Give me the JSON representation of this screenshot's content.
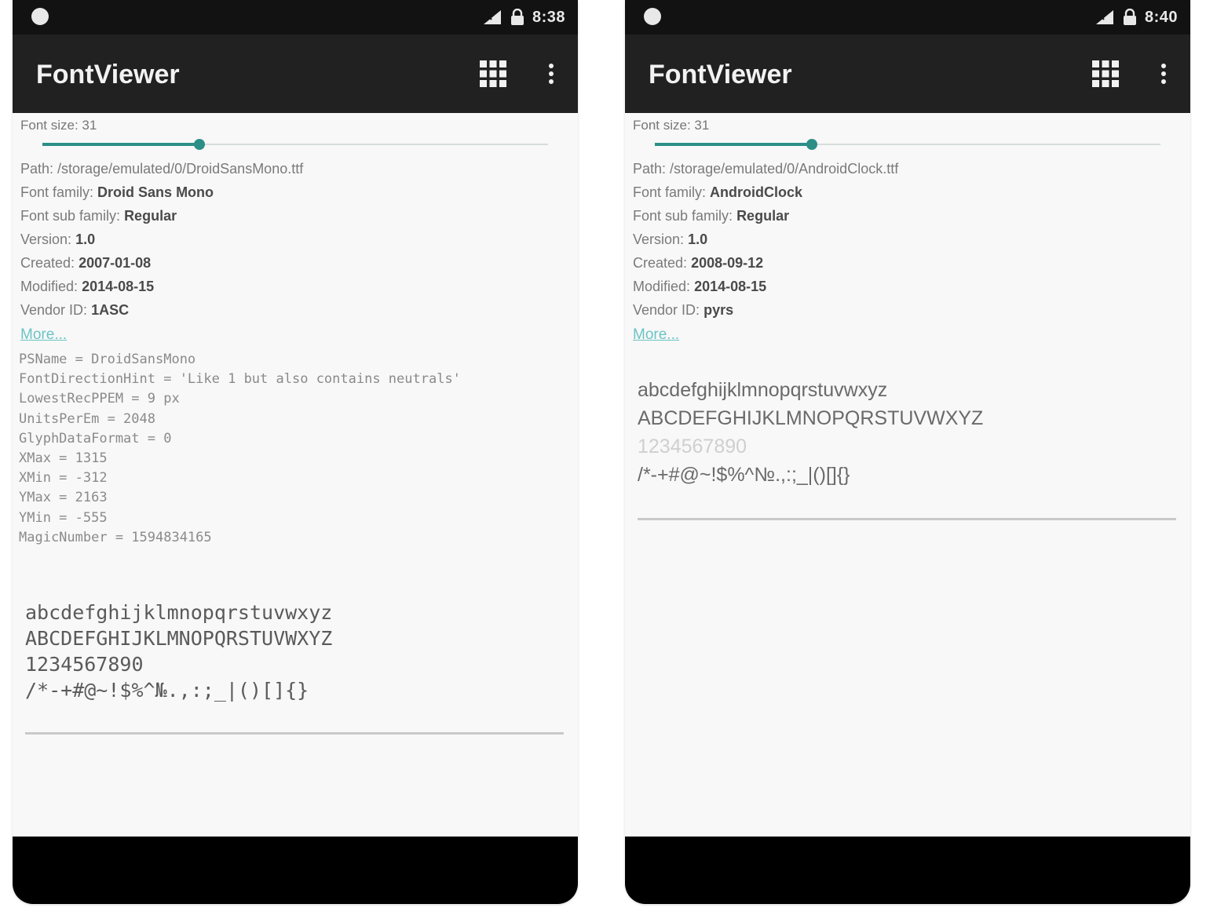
{
  "screens": [
    {
      "status": {
        "time": "8:38"
      },
      "app_bar": {
        "title": "FontViewer",
        "grid_icon": "grid-view-icon",
        "more_icon": "more-vert-icon"
      },
      "font_size": {
        "label": "Font size: 31",
        "slider_fraction": 0.31
      },
      "info": {
        "path_label": "Path:",
        "path_value": "/storage/emulated/0/DroidSansMono.ttf",
        "family_label": "Font family:",
        "family_value": "Droid Sans Mono",
        "subfamily_label": "Font sub family:",
        "subfamily_value": "Regular",
        "version_label": "Version:",
        "version_value": "1.0",
        "created_label": "Created:",
        "created_value": "2007-01-08",
        "modified_label": "Modified:",
        "modified_value": "2014-08-15",
        "vendor_label": "Vendor ID:",
        "vendor_value": "1ASC"
      },
      "more_link": "More...",
      "details": [
        "PSName = DroidSansMono",
        "FontDirectionHint = 'Like 1 but also contains neutrals'",
        "LowestRecPPEM = 9 px",
        "UnitsPerEm = 2048",
        "GlyphDataFormat = 0",
        "XMax = 1315",
        "XMin = -312",
        "YMax = 2163",
        "YMin = -555",
        "MagicNumber = 1594834165"
      ],
      "sample": {
        "lowercase": "abcdefghijklmnopqrstuvwxyz",
        "uppercase": "ABCDEFGHIJKLMNOPQRSTUVWXYZ",
        "digits": "1234567890",
        "symbols": "/*-+#@~!$%^№.,:;_|()[]{}"
      }
    },
    {
      "status": {
        "time": "8:40"
      },
      "app_bar": {
        "title": "FontViewer",
        "grid_icon": "grid-view-icon",
        "more_icon": "more-vert-icon"
      },
      "font_size": {
        "label": "Font size: 31",
        "slider_fraction": 0.31
      },
      "info": {
        "path_label": "Path:",
        "path_value": "/storage/emulated/0/AndroidClock.ttf",
        "family_label": "Font family:",
        "family_value": "AndroidClock",
        "subfamily_label": "Font sub family:",
        "subfamily_value": "Regular",
        "version_label": "Version:",
        "version_value": "1.0",
        "created_label": "Created:",
        "created_value": "2008-09-12",
        "modified_label": "Modified:",
        "modified_value": "2014-08-15",
        "vendor_label": "Vendor ID:",
        "vendor_value": "pyrs"
      },
      "more_link": "More...",
      "sample": {
        "lowercase": "abcdefghijklmnopqrstuvwxyz",
        "uppercase": "ABCDEFGHIJKLMNOPQRSTUVWXYZ",
        "digits": "1234567890",
        "symbols": "/*-+#@~!$%^№.,:;_|()[]{}"
      }
    }
  ],
  "colors": {
    "status_bar": "#121212",
    "app_bar": "#212121",
    "accent": "#2b8f87",
    "link": "#6cc4c4",
    "nav_bar": "#000000"
  }
}
